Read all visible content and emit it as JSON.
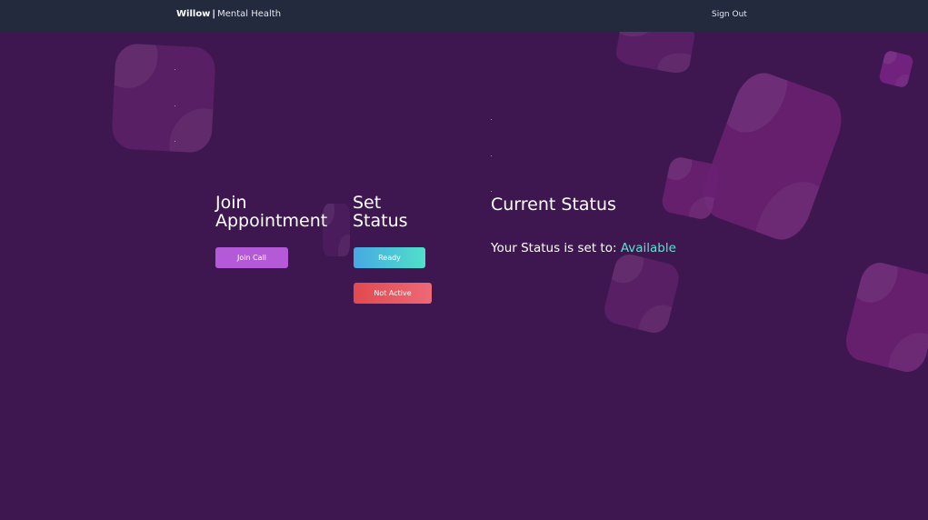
{
  "header": {
    "brand_name": "Willow",
    "brand_separator": "|",
    "brand_subtitle": "Mental Health",
    "signout_label": "Sign Out"
  },
  "join": {
    "heading_line1": "Join",
    "heading_line2": "Appointment",
    "button_label": "Join Call"
  },
  "set_status": {
    "heading_line1": "Set",
    "heading_line2": "Status",
    "ready_label": "Ready",
    "not_active_label": "Not Active"
  },
  "current_status": {
    "heading": "Current Status",
    "prefix": "Your Status is set to:",
    "value": "Available"
  },
  "colors": {
    "background": "#3f1750",
    "topbar": "#232a3e",
    "join_button": "#b45ad9",
    "ready_gradient_start": "#47a8e4",
    "ready_gradient_end": "#4fe0c9",
    "not_active_start": "#e14a4f",
    "not_active_end": "#ee6876",
    "status_value": "#5fe0d0",
    "decor_shape": "#6c2173"
  }
}
